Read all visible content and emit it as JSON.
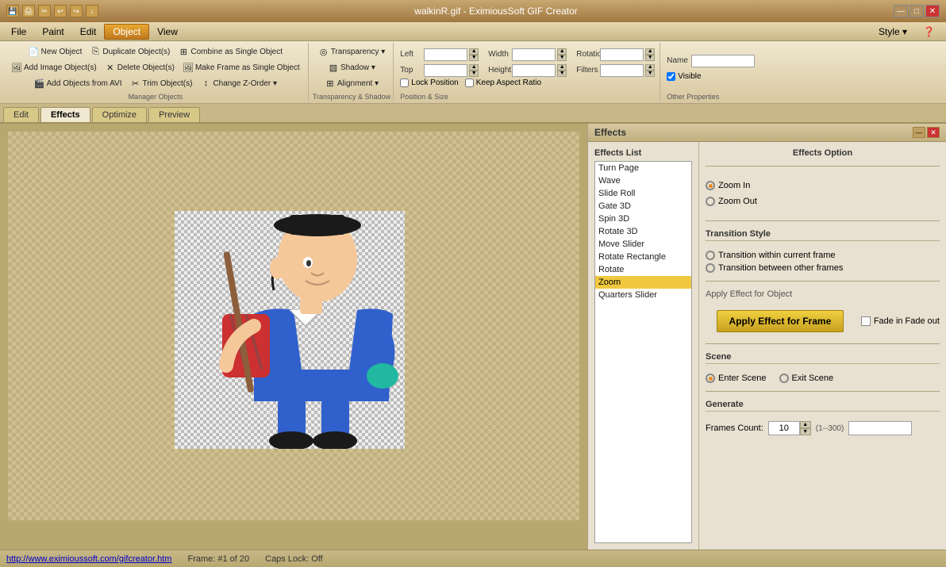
{
  "titleBar": {
    "title": "walkinR.gif - EximiousSoft GIF Creator",
    "icons": [
      "💾",
      "🖨",
      "✂"
    ],
    "styleLabelText": "Style ▾"
  },
  "menuBar": {
    "items": [
      "File",
      "Paint",
      "Edit",
      "Object",
      "View"
    ],
    "activeItem": "Object"
  },
  "toolbar": {
    "managerObjects": {
      "label": "Manager Objects",
      "row1": [
        "New  Object",
        "Add Image Object(s)",
        "Add Objects from AVI"
      ],
      "row2": [
        "Duplicate Object(s)",
        "Delete Object(s)",
        "Trim Object(s)"
      ],
      "row3": [
        "Combine as Single Object",
        "Make Frame as Single Object",
        "Change Z-Order ▾"
      ]
    },
    "transparencyShadow": {
      "label": "Transparency & Shadow",
      "transparency": "Transparency ▾",
      "shadow": "Shadow ▾",
      "alignment": "Alignment ▾"
    },
    "positionSize": {
      "label": "Position & Size",
      "leftLabel": "Left",
      "leftValue": "",
      "topLabel": "Top",
      "topValue": "",
      "widthLabel": "Width",
      "widthValue": "",
      "heightLabel": "Height",
      "heightValue": "",
      "lockPosition": "Lock Position",
      "keepAspectRatio": "Keep Aspect Ratio",
      "rotationLabel": "Rotation",
      "rotationValue": "",
      "filtersLabel": "Filters",
      "filtersValue": ""
    },
    "otherProperties": {
      "label": "Other Properties",
      "nameLabel": "Name",
      "nameValue": "",
      "visibleLabel": "Visible"
    }
  },
  "tabs": [
    "Edit",
    "Effects",
    "Optimize",
    "Preview"
  ],
  "activeTab": "Effects",
  "effectsPanel": {
    "title": "Effects",
    "effectsList": {
      "title": "Effects List",
      "items": [
        "Turn Page",
        "Wave",
        "Slide Roll",
        "Gate 3D",
        "Spin 3D",
        "Rotate 3D",
        "Move Slider",
        "Rotate Rectangle",
        "Rotate",
        "Zoom",
        "Quarters Slider"
      ],
      "selectedItem": "Zoom"
    },
    "effectsOption": {
      "title": "Effects Option",
      "zoomIn": "Zoom In",
      "zoomOut": "Zoom Out",
      "zoomInSelected": true
    },
    "transitionStyle": {
      "title": "Transition Style",
      "withinFrame": "Transition within current frame",
      "betweenFrames": "Transition between other frames"
    },
    "applyEffect": {
      "objectLabel": "Apply Effect for Object",
      "frameButtonLabel": "Apply Effect  for Frame",
      "fadeInFadeOut": "Fade in Fade out"
    },
    "scene": {
      "title": "Scene",
      "enterScene": "Enter Scene",
      "exitScene": "Exit Scene",
      "enterSelected": true
    },
    "generate": {
      "title": "Generate",
      "framesCountLabel": "Frames Count:",
      "framesCountValue": "10",
      "framesHint": "(1--300)"
    }
  },
  "statusBar": {
    "link": "http://www.eximioussoft.com/gifcreator.htm",
    "frameInfo": "Frame: #1 of 20",
    "capsLock": "Caps Lock: Off"
  }
}
